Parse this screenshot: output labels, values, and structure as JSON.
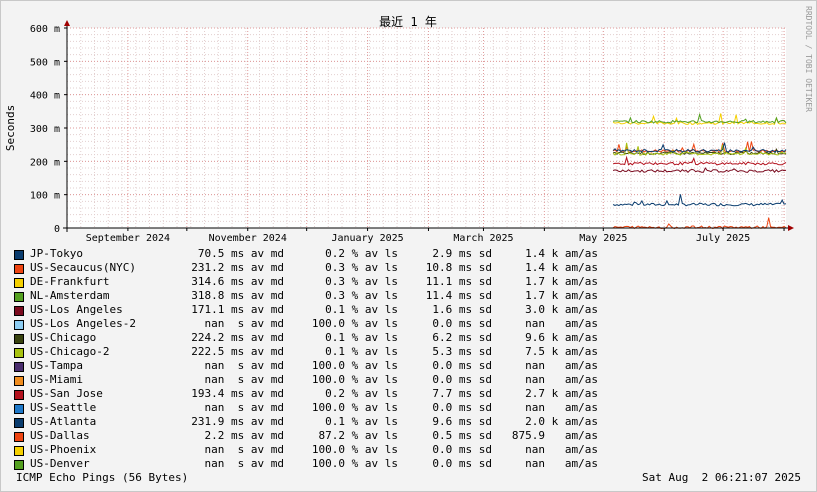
{
  "chart_data": {
    "type": "line",
    "title": "最近 1 年",
    "ylabel": "Seconds",
    "watermark": "RRDTOOL / TOBI OETIKER",
    "y_ticks": [
      {
        "value": 0,
        "label": "0"
      },
      {
        "value": 0.1,
        "label": "100 m"
      },
      {
        "value": 0.2,
        "label": "200 m"
      },
      {
        "value": 0.3,
        "label": "300 m"
      },
      {
        "value": 0.4,
        "label": "400 m"
      },
      {
        "value": 0.5,
        "label": "500 m"
      },
      {
        "value": 0.6,
        "label": "600 m"
      }
    ],
    "ylim": [
      0,
      0.6
    ],
    "x_domain": [
      "2024-08-01",
      "2025-08-02"
    ],
    "x_ticks": [
      {
        "date": "2024-09-01",
        "label": "September 2024"
      },
      {
        "date": "2024-11-01",
        "label": "November 2024"
      },
      {
        "date": "2025-01-01",
        "label": "January 2025"
      },
      {
        "date": "2025-03-01",
        "label": "March 2025"
      },
      {
        "date": "2025-05-01",
        "label": "May 2025"
      },
      {
        "date": "2025-07-01",
        "label": "July 2025"
      }
    ],
    "grid": true,
    "data_start": "2025-05-06",
    "series": [
      {
        "name": "JP-Tokyo",
        "color": "#0a3c6e",
        "avg": 0.0705,
        "avg_label": "70.5 ms av md",
        "loss_label": "0.2 % av ls",
        "sd_label": "2.9 ms sd",
        "ratio_label": "1.4 k am/as"
      },
      {
        "name": "US-Secaucus(NYC)",
        "color": "#ee4411",
        "avg": 0.2312,
        "avg_label": "231.2 ms av md",
        "loss_label": "0.3 % av ls",
        "sd_label": "10.8 ms sd",
        "ratio_label": "1.4 k am/as"
      },
      {
        "name": "DE-Frankfurt",
        "color": "#f5d000",
        "avg": 0.3146,
        "avg_label": "314.6 ms av md",
        "loss_label": "0.3 % av ls",
        "sd_label": "11.1 ms sd",
        "ratio_label": "1.7 k am/as"
      },
      {
        "name": "NL-Amsterdam",
        "color": "#54a020",
        "avg": 0.3188,
        "avg_label": "318.8 ms av md",
        "loss_label": "0.3 % av ls",
        "sd_label": "11.4 ms sd",
        "ratio_label": "1.7 k am/as"
      },
      {
        "name": "US-Los Angeles",
        "color": "#7a0a1e",
        "avg": 0.1711,
        "avg_label": "171.1 ms av md",
        "loss_label": "0.1 % av ls",
        "sd_label": "1.6 ms sd",
        "ratio_label": "3.0 k am/as"
      },
      {
        "name": "US-Los Angeles-2",
        "color": "#8ecdf2",
        "avg": null,
        "avg_label": "nan  s av md",
        "loss_label": "100.0 % av ls",
        "sd_label": "0.0 ms sd",
        "ratio_label": "nan   am/as"
      },
      {
        "name": "US-Chicago",
        "color": "#38420e",
        "avg": 0.2242,
        "avg_label": "224.2 ms av md",
        "loss_label": "0.1 % av ls",
        "sd_label": "6.2 ms sd",
        "ratio_label": "9.6 k am/as"
      },
      {
        "name": "US-Chicago-2",
        "color": "#a8c210",
        "avg": 0.2225,
        "avg_label": "222.5 ms av md",
        "loss_label": "0.1 % av ls",
        "sd_label": "5.3 ms sd",
        "ratio_label": "7.5 k am/as"
      },
      {
        "name": "US-Tampa",
        "color": "#4a2d6e",
        "avg": null,
        "avg_label": "nan  s av md",
        "loss_label": "100.0 % av ls",
        "sd_label": "0.0 ms sd",
        "ratio_label": "nan   am/as"
      },
      {
        "name": "US-Miami",
        "color": "#f08c1e",
        "avg": null,
        "avg_label": "nan  s av md",
        "loss_label": "100.0 % av ls",
        "sd_label": "0.0 ms sd",
        "ratio_label": "nan   am/as"
      },
      {
        "name": "US-San Jose",
        "color": "#b4121e",
        "avg": 0.1934,
        "avg_label": "193.4 ms av md",
        "loss_label": "0.2 % av ls",
        "sd_label": "7.7 ms sd",
        "ratio_label": "2.7 k am/as"
      },
      {
        "name": "US-Seattle",
        "color": "#1e78c8",
        "avg": null,
        "avg_label": "nan  s av md",
        "loss_label": "100.0 % av ls",
        "sd_label": "0.0 ms sd",
        "ratio_label": "nan   am/as"
      },
      {
        "name": "US-Atlanta",
        "color": "#0a3c6e",
        "avg": 0.2319,
        "avg_label": "231.9 ms av md",
        "loss_label": "0.1 % av ls",
        "sd_label": "9.6 ms sd",
        "ratio_label": "2.0 k am/as"
      },
      {
        "name": "US-Dallas",
        "color": "#ee4411",
        "avg": 0.0022,
        "avg_label": "2.2 ms av md",
        "loss_label": "87.2 % av ls",
        "sd_label": "0.5 ms sd",
        "ratio_label": "875.9   am/as"
      },
      {
        "name": "US-Phoenix",
        "color": "#f5d000",
        "avg": null,
        "avg_label": "nan  s av md",
        "loss_label": "100.0 % av ls",
        "sd_label": "0.0 ms sd",
        "ratio_label": "nan   am/as"
      },
      {
        "name": "US-Denver",
        "color": "#54a020",
        "avg": null,
        "avg_label": "nan  s av md",
        "loss_label": "100.0 % av ls",
        "sd_label": "0.0 ms sd",
        "ratio_label": "nan   am/as"
      }
    ]
  },
  "footer": {
    "left": "ICMP Echo Pings (56 Bytes)",
    "right": "Sat Aug  2 06:21:07 2025"
  }
}
